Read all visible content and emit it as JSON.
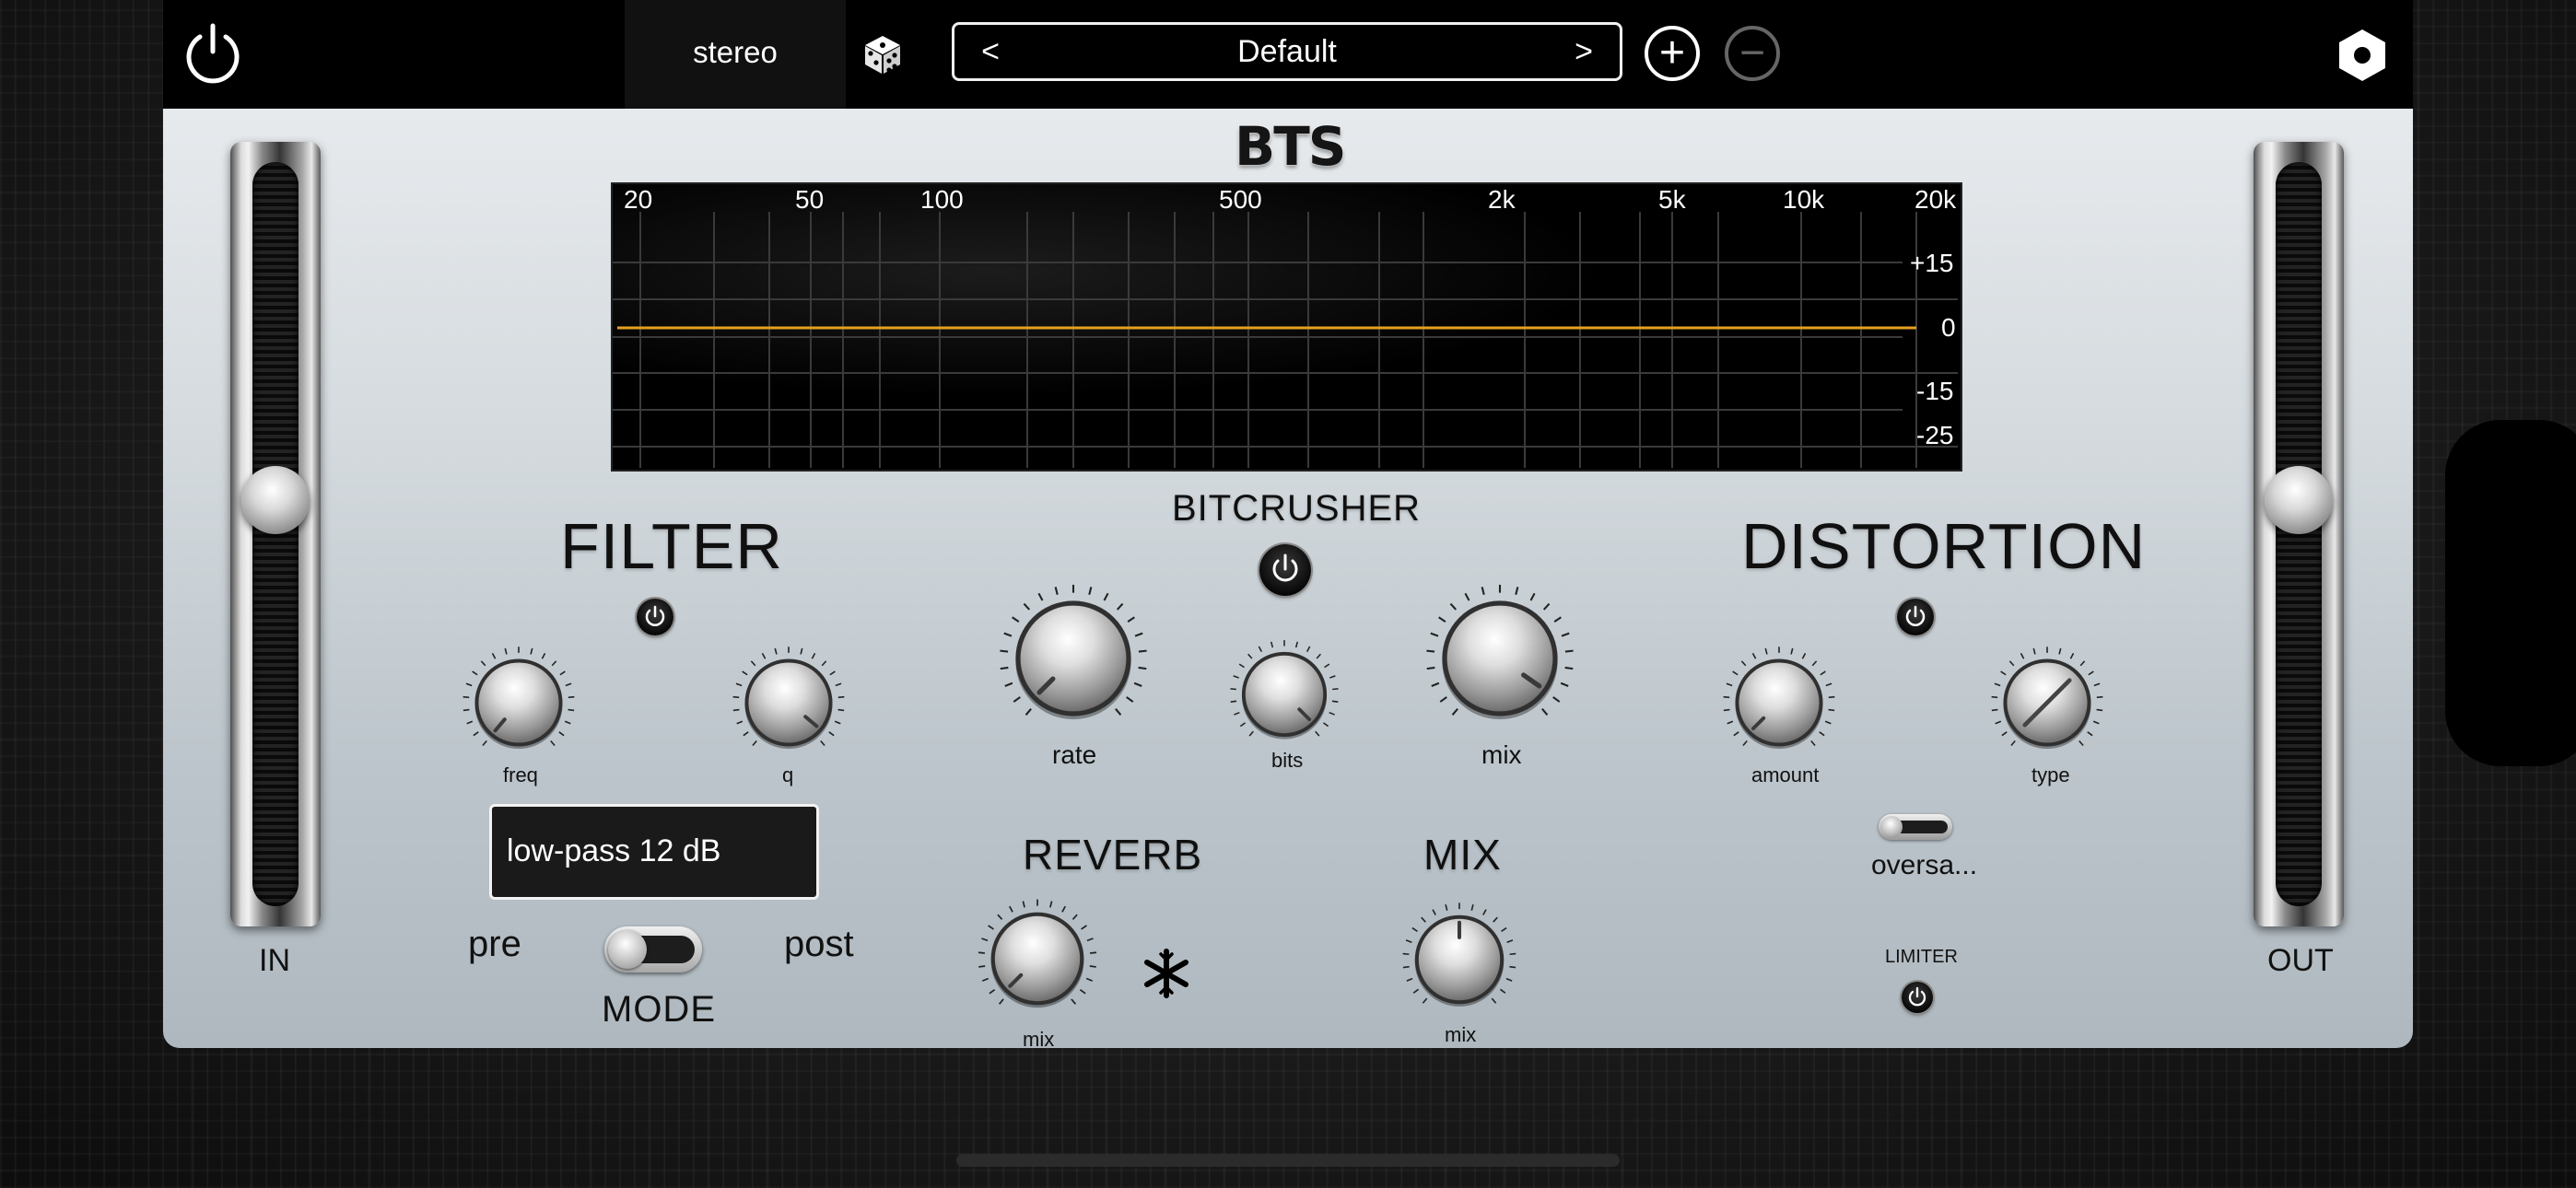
{
  "header": {
    "channel_mode": "stereo",
    "preset_name": "Default",
    "prev_arrow": "<",
    "next_arrow": ">",
    "add_glyph": "+",
    "remove_glyph": "−"
  },
  "logo": "BTS",
  "eq_display": {
    "freq_labels": [
      "20",
      "50",
      "100",
      "500",
      "2k",
      "5k",
      "10k",
      "20k"
    ],
    "gain_labels": [
      "+15",
      "0",
      "-15",
      "-25"
    ],
    "curve_color": "#e6a020",
    "curve_gain_db": 0
  },
  "input_slider": {
    "label": "IN"
  },
  "output_slider": {
    "label": "OUT"
  },
  "filter": {
    "title": "FILTER",
    "freq_label": "freq",
    "q_label": "q",
    "type_value": "low-pass  12 dB",
    "pre_label": "pre",
    "post_label": "post",
    "mode_label": "MODE"
  },
  "bitcrusher": {
    "title": "BITCRUSHER",
    "rate_label": "rate",
    "bits_label": "bits",
    "mix_label": "mix"
  },
  "distortion": {
    "title": "DISTORTION",
    "amount_label": "amount",
    "type_label": "type",
    "oversampling_label": "oversa...",
    "limiter_label": "LIMITER"
  },
  "reverb": {
    "title": "REVERB",
    "mix_label": "mix"
  },
  "mix_section": {
    "title": "MIX",
    "mix_label": "mix"
  },
  "colors": {
    "panel": "#c9d0d5",
    "eq_curve": "#e6a020",
    "topbar": "#000000"
  }
}
